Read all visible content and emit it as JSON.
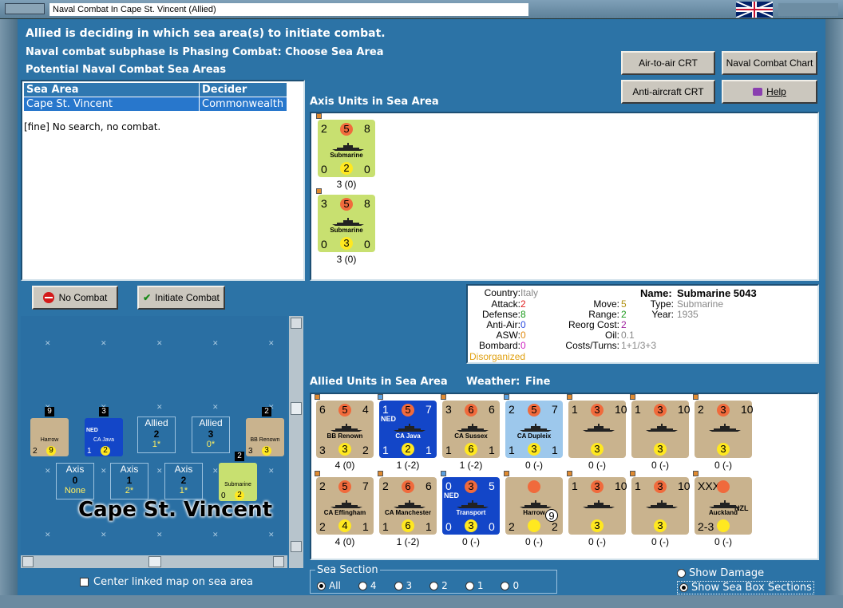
{
  "window": {
    "title": "Naval Combat In Cape St. Vincent (Allied)"
  },
  "header": {
    "line1": "Allied is deciding in which sea area(s) to initiate combat.",
    "line2": "Naval combat subphase is Phasing Combat: Choose Sea Area",
    "line3": "Potential Naval Combat Sea Areas"
  },
  "buttons": {
    "air": "Air-to-air CRT",
    "naval": "Naval Combat Chart",
    "aa": "Anti-aircraft CRT",
    "help": "Help",
    "nocombat": "No Combat",
    "initiate": "Initiate Combat"
  },
  "sea_table": {
    "col1": "Sea Area",
    "col2": "Decider",
    "rows": [
      {
        "area": "Cape St. Vincent",
        "decider": "Commonwealth"
      }
    ]
  },
  "search_result": "[fine]  No search, no combat.",
  "axis_title": "Axis Units in Sea Area",
  "axis_units": [
    {
      "top": [
        "2",
        "5",
        "8"
      ],
      "name": "Submarine",
      "bottom": [
        "0",
        "2",
        "0"
      ],
      "caption": "3 (0)"
    },
    {
      "top": [
        "3",
        "5",
        "8"
      ],
      "name": "Submarine",
      "bottom": [
        "0",
        "3",
        "0"
      ],
      "caption": "3 (0)"
    }
  ],
  "info": {
    "country_label": "Country:",
    "country": "Italy",
    "attack_label": "Attack:",
    "attack": "2",
    "defense_label": "Defense:",
    "defense": "8",
    "aa_label": "Anti-Air:",
    "aa": "0",
    "asw_label": "ASW:",
    "asw": "0",
    "bombard_label": "Bombard:",
    "bombard": "0",
    "status": "Disorganized",
    "name_label": "Name:",
    "name": "Submarine 5043",
    "move_label": "Move:",
    "move": "5",
    "type_label": "Type:",
    "type": "Submarine",
    "range_label": "Range:",
    "range": "2",
    "year_label": "Year:",
    "year": "1935",
    "reorg_label": "Reorg Cost:",
    "reorg": "2",
    "oil_label": "Oil:",
    "oil": "0.1",
    "costs_label": "Costs/Turns:",
    "costs": "1+1/3+3"
  },
  "allied_title": "Allied Units in Sea Area",
  "weather_label": "Weather:",
  "weather": "Fine",
  "allied_units": [
    {
      "top": [
        "6",
        "5",
        "4"
      ],
      "name": "BB Renown",
      "bottom": [
        "3",
        "3",
        "2"
      ],
      "caption": "4 (0)",
      "style": "tan"
    },
    {
      "top": [
        "1",
        "5",
        "7"
      ],
      "name": "CA Java",
      "tag": "NED",
      "bottom": [
        "1",
        "2",
        "1"
      ],
      "caption": "1 (-2)",
      "style": "blue"
    },
    {
      "top": [
        "3",
        "6",
        "6"
      ],
      "name": "CA Sussex",
      "bottom": [
        "1",
        "6",
        "1"
      ],
      "caption": "1 (-2)",
      "style": "tan"
    },
    {
      "top": [
        "2",
        "5",
        "7"
      ],
      "name": "CA Dupleix",
      "bottom": [
        "1",
        "3",
        "1"
      ],
      "caption": "0 (-)",
      "style": "lightblue"
    },
    {
      "top": [
        "1",
        "3",
        "10"
      ],
      "name": "",
      "bottom": [
        "",
        "3",
        ""
      ],
      "caption": "0 (-)",
      "style": "tan"
    },
    {
      "top": [
        "1",
        "3",
        "10"
      ],
      "name": "",
      "bottom": [
        "",
        "3",
        ""
      ],
      "caption": "0 (-)",
      "style": "tan"
    },
    {
      "top": [
        "2",
        "3",
        "10"
      ],
      "name": "",
      "bottom": [
        "",
        "3",
        ""
      ],
      "caption": "0 (-)",
      "style": "tan"
    },
    {
      "top": [
        "2",
        "5",
        "7"
      ],
      "name": "CA Effingham",
      "bottom": [
        "2",
        "4",
        "1"
      ],
      "caption": "4 (0)",
      "style": "tan"
    },
    {
      "top": [
        "2",
        "6",
        "6"
      ],
      "name": "CA Manchester",
      "bottom": [
        "1",
        "6",
        "1"
      ],
      "caption": "1 (-2)",
      "style": "tan"
    },
    {
      "top": [
        "0",
        "3",
        "5"
      ],
      "name": "Transport",
      "tag": "NED",
      "bottom": [
        "0",
        "3",
        "0"
      ],
      "caption": "0 (-)",
      "style": "blue"
    },
    {
      "top": [
        "",
        "",
        ""
      ],
      "name": "Harrow",
      "bottom": [
        "2",
        "",
        "2"
      ],
      "caption": "0 (-)",
      "style": "tan",
      "badge": "9"
    },
    {
      "top": [
        "1",
        "3",
        "10"
      ],
      "name": "",
      "bottom": [
        "",
        "3",
        ""
      ],
      "caption": "0 (-)",
      "style": "tan"
    },
    {
      "top": [
        "1",
        "3",
        "10"
      ],
      "name": "",
      "bottom": [
        "",
        "3",
        ""
      ],
      "caption": "0 (-)",
      "style": "tan"
    },
    {
      "top": [
        "XXX",
        "",
        ""
      ],
      "name": "Auckland",
      "tag": "NZL",
      "bottom": [
        "2-3",
        "",
        ""
      ],
      "caption": "0 (-)",
      "style": "tan"
    }
  ],
  "map": {
    "area_name": "Cape St. Vincent",
    "allied_boxes": [
      {
        "label": "Allied",
        "num": "2",
        "sub": "1*"
      },
      {
        "label": "Allied",
        "num": "3",
        "sub": "0*"
      }
    ],
    "axis_boxes": [
      {
        "label": "Axis",
        "num": "0",
        "sub": "None"
      },
      {
        "label": "Axis",
        "num": "1",
        "sub": "2*"
      },
      {
        "label": "Axis",
        "num": "2",
        "sub": "1*"
      }
    ],
    "stack_counts": [
      "9",
      "3",
      "2",
      "2"
    ],
    "mini": [
      {
        "name": "Harrow",
        "a": "2",
        "b": "9"
      },
      {
        "name": "CA Java",
        "a": "1",
        "b": "2",
        "tag": "NED"
      },
      {
        "name": "BB Renown",
        "a": "3",
        "b": "3"
      },
      {
        "name": "Submarine",
        "a": "0",
        "b": "2"
      }
    ]
  },
  "center_linked": "Center linked map on sea area",
  "sea_section": {
    "title": "Sea Section",
    "options": [
      "All",
      "4",
      "3",
      "2",
      "1",
      "0"
    ],
    "selected": "All"
  },
  "show_damage": "Show Damage",
  "show_sections": "Show Sea Box Sections",
  "colors": {
    "bg": "#2c73a6",
    "tan": "#c9b38e",
    "blue": "#1346c8",
    "lightblue": "#9dc8ec",
    "sub": "#c8e070",
    "circ": "#f06a3c",
    "yellow": "#ffe820"
  }
}
